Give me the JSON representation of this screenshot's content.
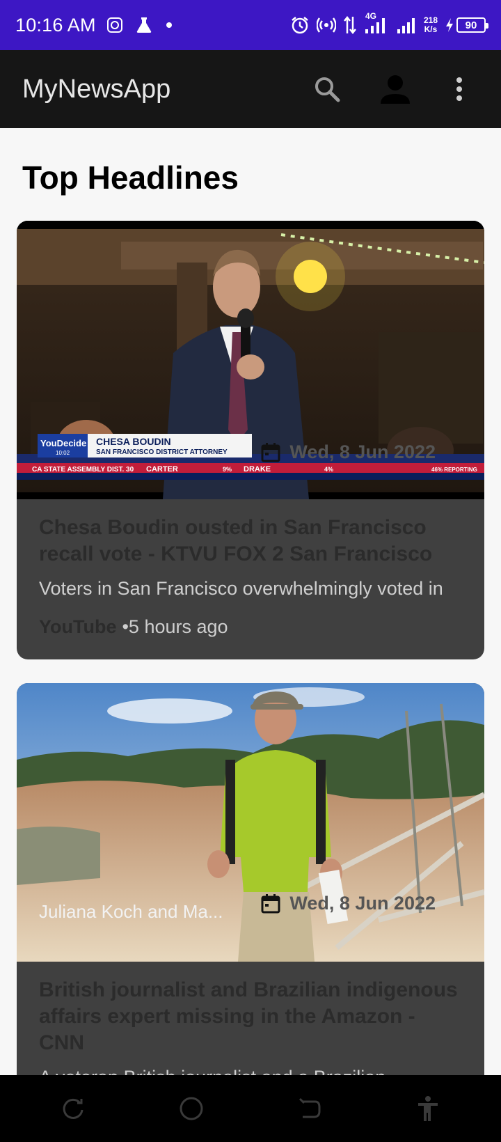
{
  "status_bar": {
    "time": "10:16 AM",
    "network_type": "4G",
    "speed_value": "218",
    "speed_unit": "K/s",
    "battery": "90",
    "background": "#3d17c4"
  },
  "app_bar": {
    "title": "MyNewsApp",
    "icons": [
      "search-icon",
      "account-icon",
      "more-vert-icon"
    ]
  },
  "main": {
    "section_title": "Top Headlines",
    "articles": [
      {
        "title": "Chesa Boudin ousted in San Francisco recall vote - KTVU FOX 2 San Francisco",
        "description": "Voters in San Francisco overwhelmingly voted in",
        "source": "YouTube",
        "time_ago": "•5 hours ago",
        "date": "Wed, 8 Jun 2022",
        "author": "",
        "lower_third": {
          "brand": "YouDecide",
          "time": "10:02",
          "name": "CHESA BOUDIN",
          "role": "SAN FRANCISCO DISTRICT ATTORNEY",
          "ticker_race": "CA STATE ASSEMBLY DIST. 30",
          "ticker_c1": "CARTER",
          "ticker_pct": "9%",
          "ticker_c2": "DRAKE",
          "ticker_pct2": "4%",
          "ticker_reporting": "46% REPORTING"
        }
      },
      {
        "title": "British journalist and Brazilian indigenous affairs expert missing in the Amazon - CNN",
        "description": "A veteran British journalist and a Brazilian",
        "source": "",
        "time_ago": "",
        "date": "Wed, 8 Jun 2022",
        "author": "Juliana Koch and Ma..."
      }
    ]
  },
  "colors": {
    "app_bar": "#161616",
    "card": "#404040",
    "page": "#f7f7f7",
    "card_title": "#2b2b2b"
  }
}
